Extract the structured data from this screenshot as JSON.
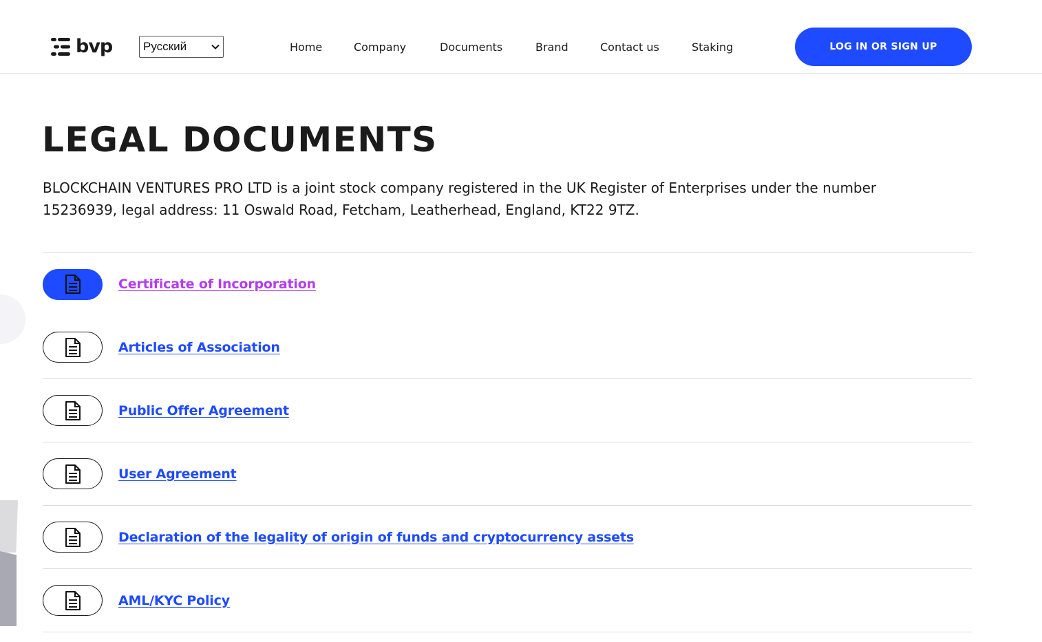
{
  "header": {
    "logo_text": "bvp",
    "language": "Русский",
    "nav": [
      "Home",
      "Company",
      "Documents",
      "Brand",
      "Contact us",
      "Staking"
    ],
    "cta_label": "LOG IN OR SIGN UP"
  },
  "main": {
    "title": "LEGAL DOCUMENTS",
    "intro": "BLOCKCHAIN VENTURES PRO LTD is a joint stock company registered in the UK Register of Enterprises under the number 15236939, legal address: 11 Oswald Road, Fetcham, Leatherhead, England, KT22 9TZ.",
    "documents": [
      {
        "label": "Certificate of Incorporation",
        "icon": "document-icon",
        "state": "visited"
      },
      {
        "label": "Articles of Association",
        "icon": "document-icon",
        "state": "default"
      },
      {
        "label": "Public Offer Agreement",
        "icon": "document-icon",
        "state": "default"
      },
      {
        "label": "User Agreement",
        "icon": "document-icon",
        "state": "default"
      },
      {
        "label": "Declaration of the legality of origin of funds and cryptocurrency assets",
        "icon": "document-icon",
        "state": "default"
      },
      {
        "label": "AML/KYC Policy",
        "icon": "document-icon",
        "state": "default"
      }
    ]
  },
  "colors": {
    "accent": "#1e4bff",
    "visited_link": "#b33df0",
    "text": "#1b1b1b",
    "divider": "#dcdce6"
  }
}
